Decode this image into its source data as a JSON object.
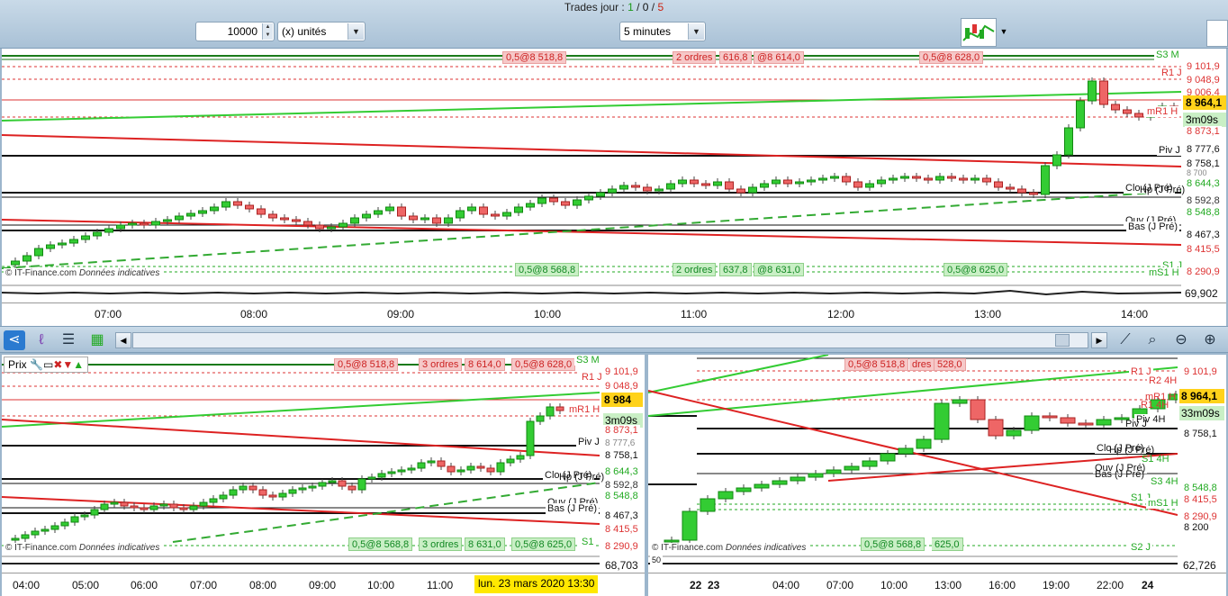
{
  "top": {
    "trades_label": "Trades jour : ",
    "trades_a": "1",
    "sep": " / ",
    "trades_b": "0",
    "trades_c": "5",
    "quantity": "10000",
    "unit": "(x) unités",
    "timeframe": "5 minutes"
  },
  "main": {
    "tags_top": [
      "0,5@8 518,8",
      "2 ordres",
      "616,8",
      "@8 614,0",
      "0,5@8 628,0"
    ],
    "tags_bottom": [
      "0,5@8 568,8",
      "2 ordres",
      "637,8",
      "@8 631,0",
      "0,5@8 625,0"
    ],
    "right_labels": [
      "S3 M",
      "9 101,9",
      "R1 J",
      "9 048,9",
      "9 006,4",
      "mR1 H",
      "8 873,1",
      "Piv J",
      "8 777,6",
      "8 758,1",
      "8 700",
      "8 644,3",
      "Clo (J Pré)",
      "Hp (J Pré)",
      "8 592,8",
      "8 548,8",
      "Ouv (J Pré)",
      "Bas (J Pré)",
      "8 467,3",
      "8 415,5",
      "S1 J",
      "mS1 H",
      "8 290,9"
    ],
    "price_badge": "8 964,1",
    "countdown": "3m09s",
    "osc_value": "69,902",
    "copyright": "© IT-Finance.com",
    "disclaimer": "Données indicatives",
    "time_axis": [
      "07:00",
      "08:00",
      "09:00",
      "10:00",
      "11:00",
      "12:00",
      "13:00",
      "14:00"
    ]
  },
  "toolbar": {
    "icons": [
      "share-icon",
      "indicator-icon",
      "drawing-icon",
      "grid-icon"
    ]
  },
  "left": {
    "prix": "Prix",
    "tags_top": [
      "0,5@8 518,8",
      "3 ordres",
      "8 614,0",
      "0,5@8 628,0"
    ],
    "tags_bottom": [
      "0,5@8 568,8",
      "3 ordres",
      "8 631,0",
      "0,5@8 625,0"
    ],
    "right_labels": [
      "S3 M",
      "9 101,9",
      "R1 J",
      "9 048,9",
      "mR1 H",
      "8 873,1",
      "Piv J",
      "8 777,6",
      "8 758,1",
      "8 644,3",
      "Clo (J Pré)",
      "Hp (J Pré)",
      "8 592,8",
      "8 548,8",
      "Ouv (J Pré)",
      "Bas (J Pré)",
      "8 467,3",
      "8 415,5",
      "S1",
      "8 290,9"
    ],
    "price_badge": "8 984",
    "countdown": "3m09s",
    "osc_value": "68,703",
    "time_axis": [
      "04:00",
      "05:00",
      "06:00",
      "07:00",
      "08:00",
      "09:00",
      "10:00",
      "11:00"
    ],
    "date_tooltip": "lun. 23 mars 2020 13:30"
  },
  "right": {
    "tags_top": [
      "0,5@8 518,8",
      "dres",
      "528,0"
    ],
    "tags_bottom": [
      "0,5@8 568,8",
      "625,0"
    ],
    "right_labels": [
      "9 101,9",
      "R1 J",
      "R2 4H",
      "mR1 H",
      "R1 4H",
      "Piv 4H",
      "Piv J",
      "Clo (J Pré)",
      "Hp (J Pré)",
      "S1 4H",
      "Ouv (J Pré)",
      "Bas (J Pré)",
      "S3 4H",
      "S1 J",
      "mS1 H",
      "S2 J",
      "8 758,1",
      "8 548,8",
      "8 415,5",
      "8 290,9",
      "8 200"
    ],
    "price_badge": "8 964,1",
    "countdown": "33m09s",
    "osc_value": "62,726",
    "osc_level": "50",
    "time_axis": [
      "22",
      "23",
      "04:00",
      "07:00",
      "10:00",
      "13:00",
      "16:00",
      "19:00",
      "22:00",
      "24"
    ]
  }
}
